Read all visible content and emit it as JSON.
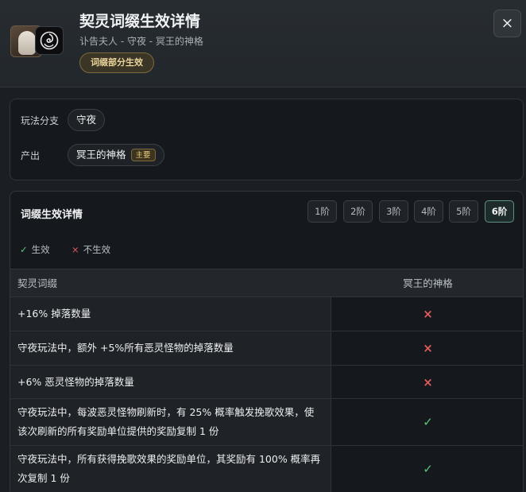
{
  "header": {
    "title": "契灵词缀生效详情",
    "subtitle": "讣告夫人 - 守夜 - 冥王的神格",
    "status_badge": "词缀部分生效",
    "close_label": "×"
  },
  "info": {
    "mode_label": "玩法分支",
    "mode_value": "守夜",
    "output_label": "产出",
    "output_value": "冥王的神格",
    "output_tag": "主要"
  },
  "detail": {
    "title": "词缀生效详情",
    "tiers": [
      "1阶",
      "2阶",
      "3阶",
      "4阶",
      "5阶",
      "6阶"
    ],
    "selected_tier": "6阶",
    "legend": {
      "active_mark": "✓",
      "active_label": "生效",
      "inactive_mark": "×",
      "inactive_label": "不生效"
    },
    "table": {
      "headers": [
        "契灵词缀",
        "冥王的神格"
      ],
      "rows": [
        {
          "affix": "+16% 掉落数量",
          "mark": "×",
          "effective": false
        },
        {
          "affix": "守夜玩法中，额外 +5%所有恶灵怪物的掉落数量",
          "mark": "×",
          "effective": false
        },
        {
          "affix": "+6% 恶灵怪物的掉落数量",
          "mark": "×",
          "effective": false
        },
        {
          "affix": "守夜玩法中，每波恶灵怪物刷新时，有 25% 概率触发挽歌效果，使该次刷新的所有奖励单位提供的奖励复制 1 份",
          "mark": "✓",
          "effective": true
        },
        {
          "affix": "守夜玩法中，所有获得挽歌效果的奖励单位，其奖励有 100% 概率再次复制 1 份",
          "mark": "✓",
          "effective": true
        }
      ]
    }
  },
  "colors": {
    "effective": "#5cc77a",
    "not_effective": "#e15b5b",
    "badge_gold": "#e9d49a"
  },
  "icons": {
    "avatar": "character-portrait",
    "emblem": "swirl-emblem-icon",
    "close": "close-icon"
  }
}
